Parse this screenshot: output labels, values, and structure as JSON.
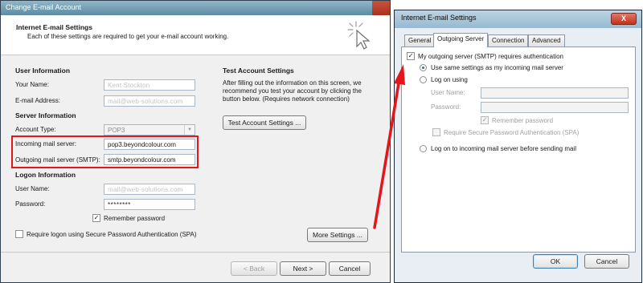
{
  "left_window": {
    "title": "Change E-mail Account",
    "header": {
      "title": "Internet E-mail Settings",
      "subtitle": "Each of these settings are required to get your e-mail account working."
    },
    "user_info": {
      "section": "User Information",
      "name_label": "Your Name:",
      "name_value": "Kent Stockton",
      "email_label": "E-mail Address:",
      "email_value": "mail@web-solutions.com"
    },
    "server_info": {
      "section": "Server Information",
      "account_type_label": "Account Type:",
      "account_type_value": "POP3",
      "incoming_label": "Incoming mail server:",
      "incoming_value": "pop3.beyondcolour.com",
      "outgoing_label": "Outgoing mail server (SMTP):",
      "outgoing_value": "smtp.beyondcolour.com"
    },
    "logon_info": {
      "section": "Logon Information",
      "username_label": "User Name:",
      "username_value": "mail@web-solutions.com",
      "password_label": "Password:",
      "password_value": "********",
      "remember_label": "Remember password",
      "remember_checked": true,
      "spa_label": "Require logon using Secure Password Authentication (SPA)",
      "spa_checked": false
    },
    "test_settings": {
      "section": "Test Account Settings",
      "description": "After filling out the information on this screen, we recommend you test your account by clicking the button below. (Requires network connection)",
      "test_button": "Test Account Settings ..."
    },
    "more_settings_button": "More Settings ...",
    "back_button": "< Back",
    "next_button": "Next >",
    "cancel_button": "Cancel",
    "highlight_color": "#e3161b"
  },
  "right_window": {
    "title": "Internet E-mail Settings",
    "close_glyph": "X",
    "tabs": [
      "General",
      "Outgoing Server",
      "Connection",
      "Advanced"
    ],
    "active_tab": "Outgoing Server",
    "smtp_auth_label": "My outgoing server (SMTP) requires authentication",
    "smtp_auth_checked": true,
    "use_same_label": "Use same settings as my incoming mail server",
    "log_on_using_label": "Log on using",
    "username_label": "User Name:",
    "password_label": "Password:",
    "remember_label": "Remember password",
    "spa_label": "Require Secure Password Authentication (SPA)",
    "log_on_incoming_label": "Log on to incoming mail server before sending mail",
    "ok_button": "OK",
    "cancel_button": "Cancel"
  },
  "annotation": {
    "arrow_color": "#e3161b"
  }
}
